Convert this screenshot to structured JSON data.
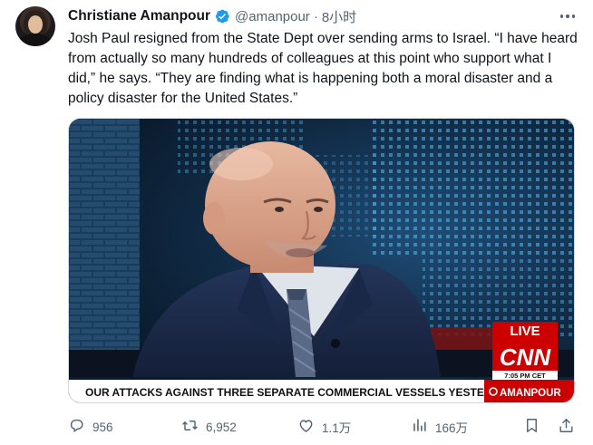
{
  "author": {
    "name": "Christiane Amanpour",
    "handle": "@amanpour",
    "separator": "·",
    "time": "8小时"
  },
  "tweet": {
    "text": "Josh Paul resigned from the State Dept over sending arms to Israel. “I have heard from actually so many hundreds of colleagues at this point who support what I did,” he says. “They are finding what is happening both a moral disaster and a policy disaster for the United States.”"
  },
  "media": {
    "live_label": "LIVE",
    "network_logo": "CNN",
    "clock": "7:05 PM CET",
    "ticker": "OUR ATTACKS AGAINST THREE SEPARATE COMMERCIAL VESSELS YESTERDAY",
    "show_name": "AMANPOUR",
    "colors": {
      "cnn_red": "#cc0000",
      "background_blue": "#12263a"
    }
  },
  "actions": {
    "reply_count": "956",
    "retweet_count": "6,952",
    "like_count": "1.1万",
    "view_count": "166万"
  },
  "icons": {
    "verified": "verified-badge-icon",
    "more": "more-options-icon",
    "reply": "reply-icon",
    "retweet": "retweet-icon",
    "like": "heart-icon",
    "views": "views-chart-icon",
    "bookmark": "bookmark-icon",
    "share": "share-icon"
  },
  "colors": {
    "accent": "#1d9bf0",
    "secondary_text": "#536471",
    "primary_text": "#0f1419"
  }
}
